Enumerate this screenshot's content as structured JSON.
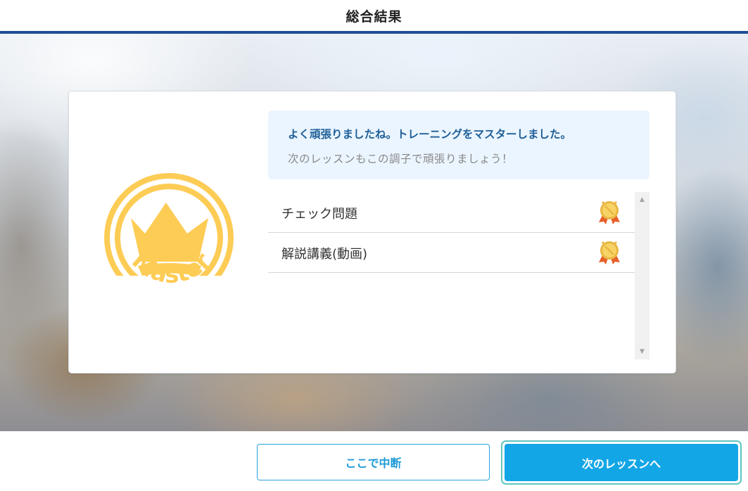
{
  "header": {
    "title": "総合結果"
  },
  "badge": {
    "text": "Master",
    "color": "#fdcc55"
  },
  "message": {
    "main": "よく頑張りましたね。トレーニングをマスターしました。",
    "sub": "次のレッスンもこの調子で頑張りましょう！"
  },
  "lessons": [
    {
      "name": "チェック問題",
      "status_icon": "gold-medal-icon"
    },
    {
      "name": "解説講義(動画)",
      "status_icon": "gold-medal-icon"
    }
  ],
  "scrollbar": {
    "up_arrow": "▲",
    "down_arrow": "▼"
  },
  "footer": {
    "pause_label": "ここで中断",
    "next_label": "次のレッスンへ"
  },
  "colors": {
    "header_accent": "#1f4e96",
    "message_text": "#1f5f98",
    "primary_button": "#13a6e6",
    "outline_button": "#2aa4db",
    "focus_ring": "#5ec5c0",
    "badge_gold": "#fdcc55"
  }
}
